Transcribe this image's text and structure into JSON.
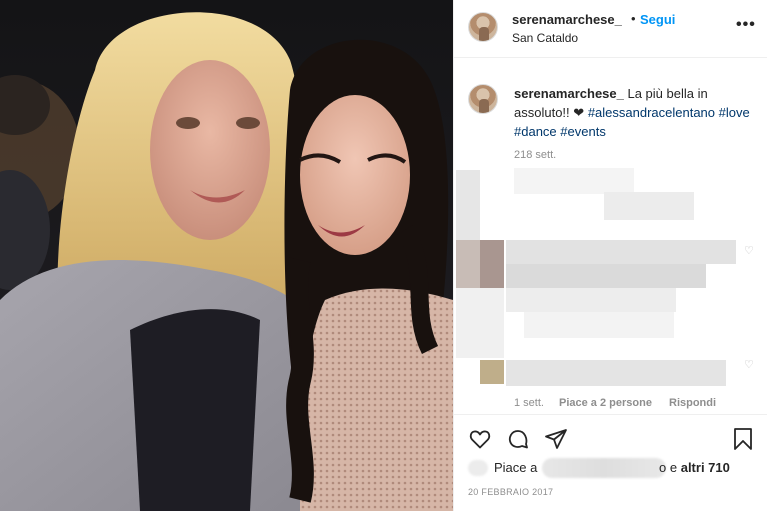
{
  "post": {
    "username": "serenamarchese_",
    "separator": "•",
    "follow_label": "Segui",
    "location": "San Cataldo",
    "more_label": "•••"
  },
  "caption": {
    "username": "serenamarchese_",
    "text": "La più bella in assoluto!!",
    "heart": "❤",
    "hashtags": [
      "#alessandracelentano",
      "#love",
      "#dance",
      "#events"
    ],
    "time": "218 sett."
  },
  "comment_actions": {
    "time": "1 sett.",
    "likes": "Piace a 2 persone",
    "reply": "Rispondi"
  },
  "likes": {
    "prefix": "Piace a",
    "suffix_letter": "o",
    "conjunction": "e",
    "others": "altri 710"
  },
  "date": "20 FEBBRAIO 2017",
  "icons": [
    "heart-icon",
    "comment-icon",
    "share-icon",
    "bookmark-icon",
    "more-icon"
  ],
  "colors": {
    "follow": "#0095f6",
    "hashtag": "#00376b",
    "muted": "#8e8e8e",
    "text": "#262626"
  }
}
